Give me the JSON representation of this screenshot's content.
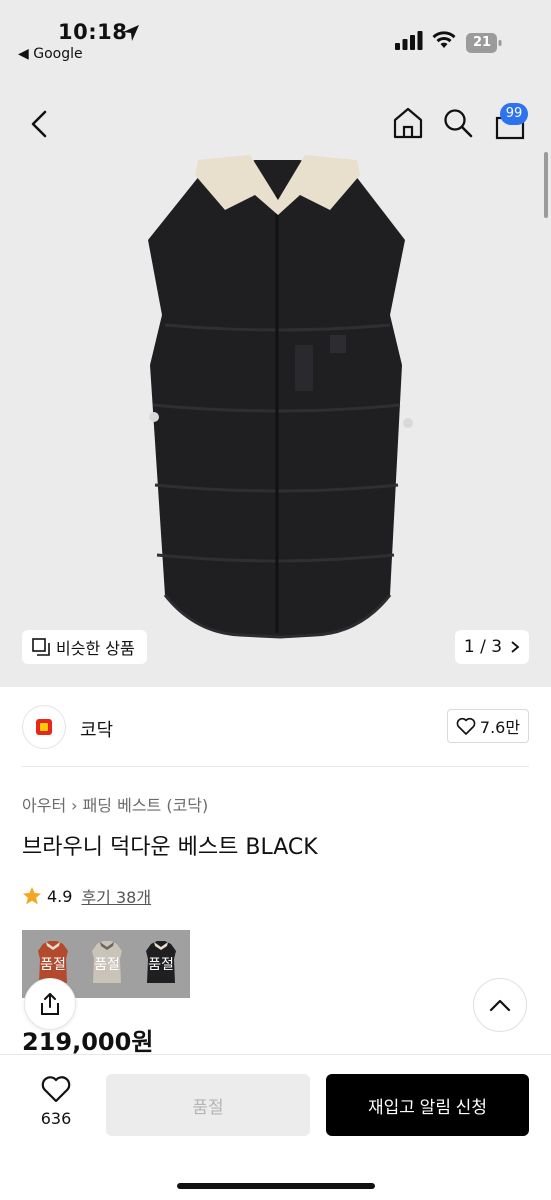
{
  "status_bar": {
    "time": "10:18",
    "back_app": "◀ Google",
    "battery": "21"
  },
  "nav": {
    "cart_count": "99"
  },
  "gallery": {
    "similar_label": "비슷한 상품",
    "page_indicator": "1 / 3"
  },
  "brand": {
    "name": "코닥",
    "likes": "7.6만"
  },
  "product": {
    "breadcrumb": [
      "아우터",
      "패딩 베스트 (코닥)"
    ],
    "title": "브라우니 덕다운 베스트 BLACK",
    "rating": "4.9",
    "reviews": "후기 38개",
    "price": "219,000원"
  },
  "color_options": [
    {
      "label": "품절",
      "color": "#b34a2e"
    },
    {
      "label": "품절",
      "color": "#c9c3b8"
    },
    {
      "label": "품절",
      "color": "#1f1f22"
    }
  ],
  "bottom_bar": {
    "wish_count": "636",
    "soldout_label": "품절",
    "restock_label": "재입고 알림 신청"
  },
  "colors": {
    "accent_badge": "#2d72ee",
    "star": "#f5a623",
    "brand_red": "#e8271c",
    "brand_yellow": "#ffcb05"
  }
}
